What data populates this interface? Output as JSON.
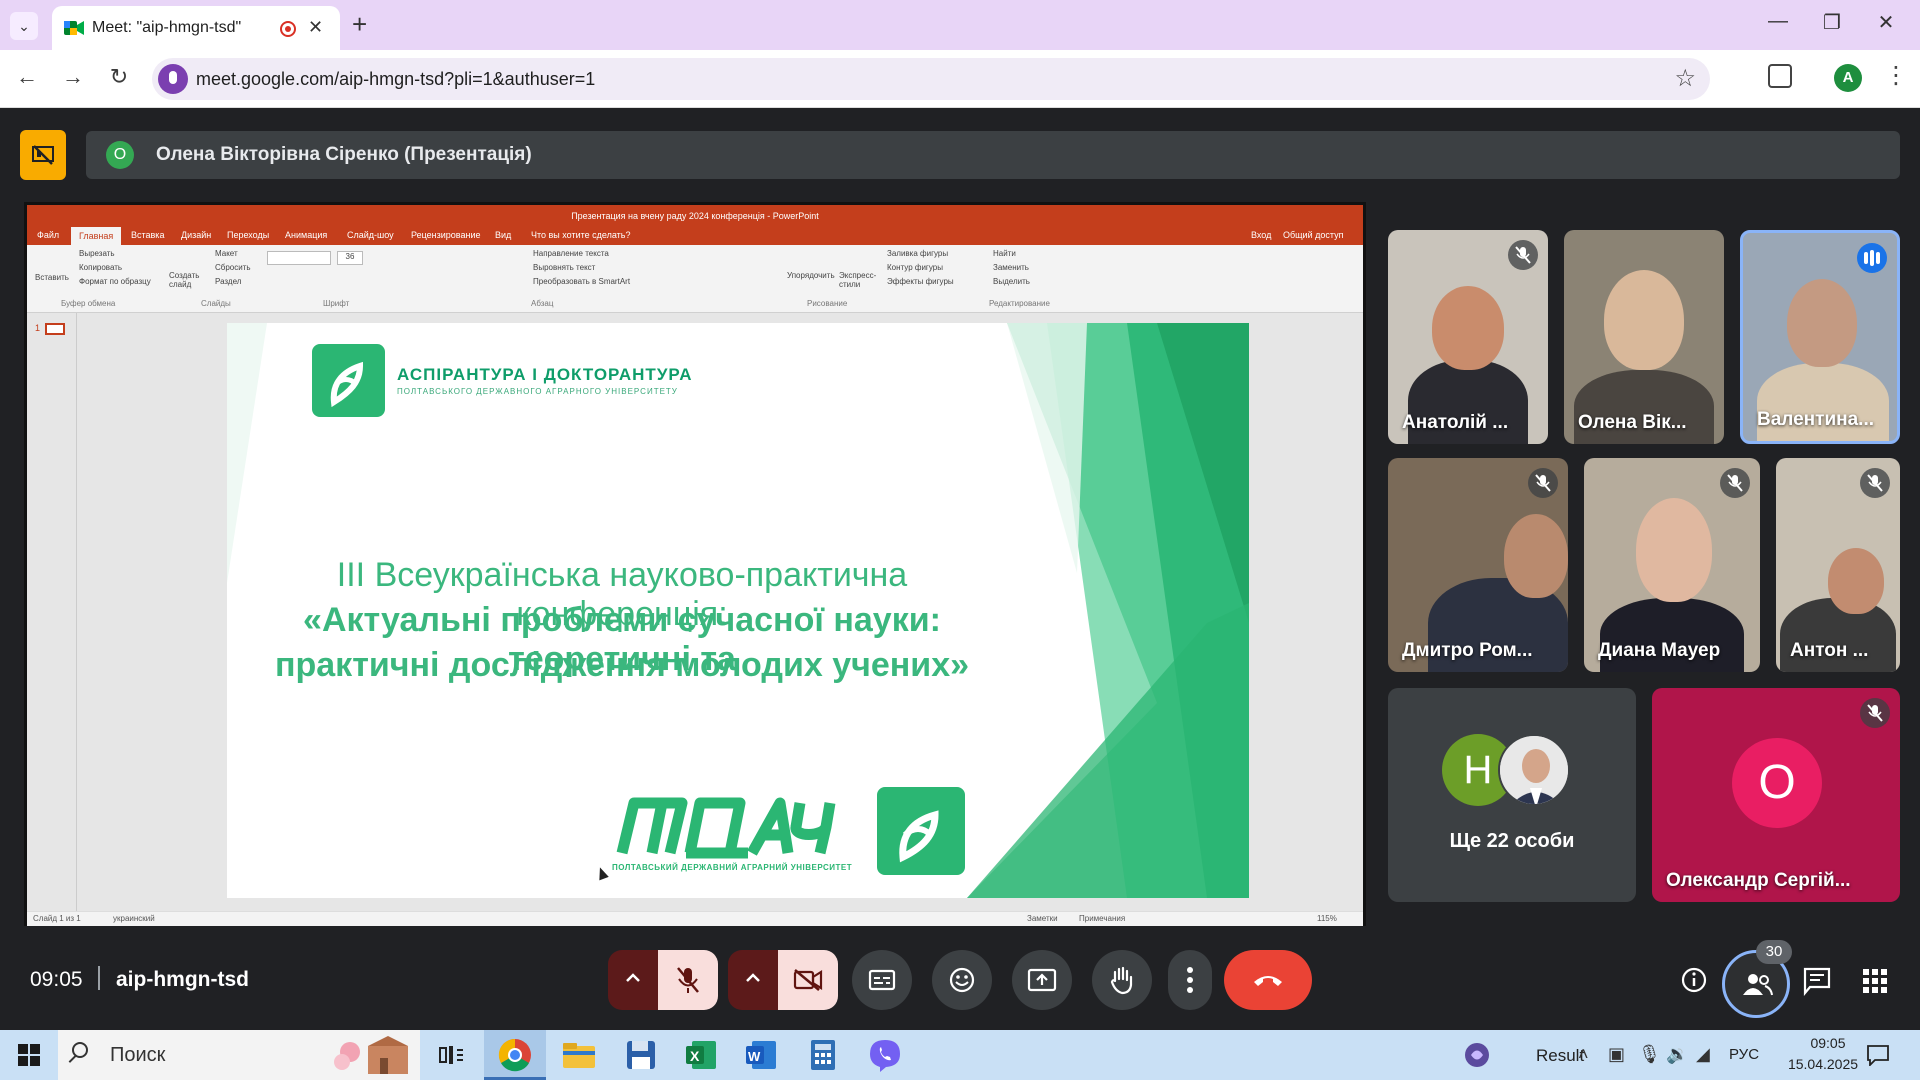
{
  "browser": {
    "tab_title": "Meet: \"aip-hmgn-tsd\"",
    "url": "meet.google.com/aip-hmgn-tsd?pli=1&authuser=1",
    "profile_initial": "A"
  },
  "meet": {
    "presenter_initial": "О",
    "presenter_label": "Олена Вікторівна Сіренко (Презентація)",
    "meeting_time": "09:05",
    "meeting_code": "aip-hmgn-tsd",
    "participant_count": "30",
    "participants": [
      {
        "name": "Анатолій ...",
        "muted": true
      },
      {
        "name": "Олена Вік...",
        "muted": false
      },
      {
        "name": "Валентина...",
        "muted": false,
        "speaking": true
      },
      {
        "name": "Дмитро Ром...",
        "muted": true
      },
      {
        "name": "Диана Мауер",
        "muted": true
      },
      {
        "name": "Антон ...",
        "muted": true
      },
      {
        "name": "Олександр Сергій...",
        "muted": true,
        "initial": "О"
      }
    ],
    "others": {
      "initial": "Н",
      "label": "Ще 22 особи"
    }
  },
  "powerpoint": {
    "window_title": "Презентация на вчену раду 2024 конференція - PowerPoint",
    "menu": [
      "Файл",
      "Главная",
      "Вставка",
      "Дизайн",
      "Переходы",
      "Анимация",
      "Слайд-шоу",
      "Рецензирование",
      "Вид",
      "Что вы хотите сделать?",
      "Вход",
      "Общий доступ"
    ],
    "ribbon": {
      "clipboard_items": [
        "Вырезать",
        "Копировать",
        "Формат по образцу"
      ],
      "paste": "Вставить",
      "clipboard_group": "Буфер обмена",
      "slides_items": [
        "Макет",
        "Сбросить",
        "Раздел"
      ],
      "new_slide": "Создать слайд",
      "slides_group": "Слайды",
      "font_group": "Шрифт",
      "font_size": "36",
      "paragraph_items": [
        "Направление текста",
        "Выровнять текст",
        "Преобразовать в SmartArt"
      ],
      "paragraph_group": "Абзац",
      "arrange": "Упорядочить",
      "quick_styles": "Экспресс-стили",
      "shape_items": [
        "Заливка фигуры",
        "Контур фигуры",
        "Эффекты фигуры"
      ],
      "drawing_group": "Рисование",
      "edit_items": [
        "Найти",
        "Заменить",
        "Выделить"
      ],
      "editing_group": "Редактирование"
    },
    "thumbnail_number": "1",
    "status": {
      "slide": "Слайд 1 из 1",
      "language": "украинский",
      "notes": "Заметки",
      "comments": "Примечания",
      "zoom": "115%"
    },
    "slide": {
      "logo_title": "АСПІРАНТУРА І ДОКТОРАНТУРА",
      "logo_subtitle": "ПОЛТАВСЬКОГО ДЕРЖАВНОГО АГРАРНОГО УНІВЕРСИТЕТУ",
      "line1": "ІІІ Всеукраїнська науково-практична конференція:",
      "line2": "«Актуальні проблеми сучасної науки: теоретичні та",
      "line3": "практичні дослідження молодих учених»",
      "brand": "ПДАУ",
      "brand_subtitle": "ПОЛТАВСЬКИЙ ДЕРЖАВНИЙ АГРАРНИЙ УНІВЕРСИТЕТ"
    }
  },
  "taskbar": {
    "search_placeholder": "Поиск",
    "tray_app": "Result",
    "language": "РУС",
    "time": "09:05",
    "date": "15.04.2025"
  },
  "colors": {
    "meet_bg": "#202124",
    "tile_bg": "#3c4043",
    "end_call": "#ea4335",
    "ppt_red": "#c43e1c",
    "slide_green": "#2bb673",
    "present_yellow": "#f9ab00"
  }
}
